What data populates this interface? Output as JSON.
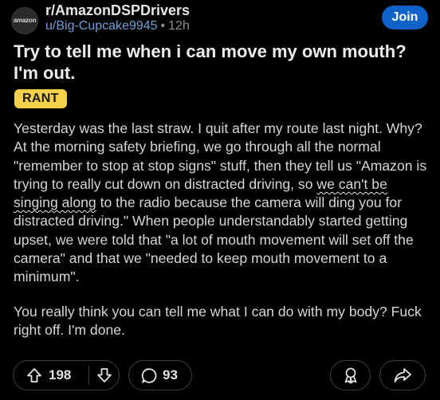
{
  "header": {
    "avatar_logo": "amazon",
    "subreddit": "r/AmazonDSPDrivers",
    "username": "u/Big-Cupcake9945",
    "separator": "•",
    "time": "12h",
    "join_label": "Join"
  },
  "post": {
    "title": "Try to tell me when i can move my own mouth? I'm out.",
    "flair": "RANT",
    "paragraph1_before": "Yesterday was the last straw. I quit after my route last night. Why? At the morning safety briefing, we go through all the normal \"remember to stop at stop signs\" stuff, then they tell us \"Amazon is trying to really cut down on distracted driving, so ",
    "paragraph1_underlined": "we can't be singing along",
    "paragraph1_after": " to the radio because the camera will ding you for distracted driving.\" When people understandably started getting upset, we were told that \"a lot of mouth movement will set off the camera\" and that we \"needed to keep mouth movement to a minimum\".",
    "paragraph2": "You really think you can tell me what I can do with my body? Fuck right off. I'm done."
  },
  "actions": {
    "upvotes": "198",
    "comments": "93"
  },
  "icons": {
    "upvote": "upvote-arrow-icon",
    "downvote": "downvote-arrow-icon",
    "comment": "comment-bubble-icon",
    "award": "award-icon",
    "share": "share-arrow-icon"
  },
  "colors": {
    "background": "#000000",
    "join_button": "#0f62c9",
    "flair": "#f5d04b",
    "username": "#6f9fd8",
    "text": "#d4d6d8"
  }
}
